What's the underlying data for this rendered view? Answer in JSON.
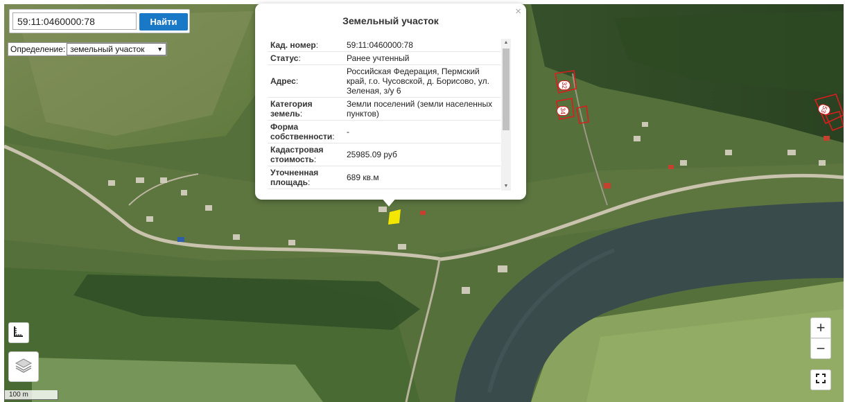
{
  "search": {
    "value": "59:11:0460000:78",
    "button_label": "Найти"
  },
  "definition": {
    "label": "Определение:",
    "selected": "земельный участок"
  },
  "popup": {
    "title": "Земельный участок",
    "close": "×",
    "rows": [
      {
        "key": "Кад. номер",
        "value": "59:11:0460000:78"
      },
      {
        "key": "Статус",
        "value": "Ранее учтенный"
      },
      {
        "key": "Адрес",
        "value": "Российская Федерация, Пермский край, г.о. Чусовской, д. Борисово, ул. Зеленая, з/у 6"
      },
      {
        "key": "Категория земель",
        "value": "Земли поселений (земли населенных пунктов)"
      },
      {
        "key": "Форма собственности",
        "value": "-"
      },
      {
        "key": "Кадастровая стоимость",
        "value": "25985.09 руб"
      },
      {
        "key": "Уточненная площадь",
        "value": "689 кв.м"
      }
    ]
  },
  "parcel_labels": [
    "32",
    "34",
    "53"
  ],
  "controls": {
    "zoom_in": "+",
    "zoom_out": "−",
    "scale": "100 m"
  },
  "icons": {
    "ruler": "ruler-icon",
    "layers": "layers-icon",
    "fullscreen": "fullscreen-icon",
    "scroll_up": "scroll-up-icon",
    "scroll_down": "scroll-down-icon"
  },
  "colors": {
    "button": "#1a79c6",
    "highlight": "#f3e600",
    "parcel_border": "#d81e1e",
    "river": "#3a4b4c"
  }
}
